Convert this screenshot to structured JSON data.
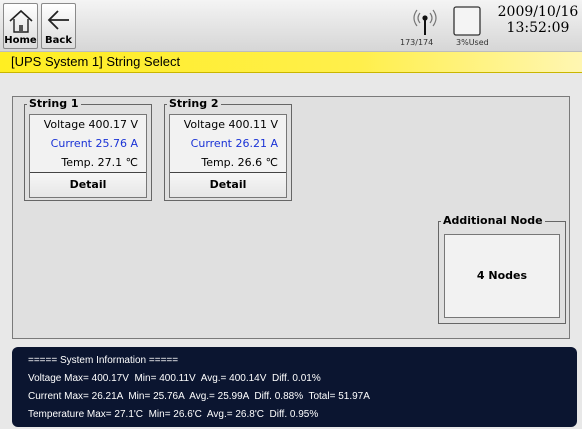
{
  "header": {
    "home_label": "Home",
    "back_label": "Back",
    "counter": "173/174",
    "memory_used": "3%Used",
    "date": "2009/10/16",
    "time": "13:52:09"
  },
  "title": "[UPS System 1] String Select",
  "strings": [
    {
      "legend": "String 1",
      "voltage": "Voltage  400.17 V",
      "current": "Current  25.76 A",
      "temp": "Temp.  27.1 ℃",
      "detail_label": "Detail"
    },
    {
      "legend": "String 2",
      "voltage": "Voltage  400.11 V",
      "current": "Current  26.21 A",
      "temp": "Temp.  26.6 ℃",
      "detail_label": "Detail"
    }
  ],
  "additional_node": {
    "legend": "Additional Node",
    "button_label": "4 Nodes"
  },
  "system_info": {
    "heading": "===== System Information =====",
    "voltage": "Voltage Max= 400.17V  Min= 400.11V  Avg.= 400.14V  Diff. 0.01%",
    "current": "Current Max= 26.21A  Min= 25.76A  Avg.= 25.99A  Diff. 0.88%  Total= 51.97A",
    "temperature": "Temperature Max= 27.1'C  Min= 26.6'C  Avg.= 26.8'C  Diff. 0.95%"
  },
  "colors": {
    "title_bar": "#ffee22",
    "current_text": "#1a33d6",
    "info_panel": "#0b1530"
  },
  "icons": [
    "home-icon",
    "back-arrow-icon",
    "antenna-icon",
    "memory-card-icon"
  ]
}
